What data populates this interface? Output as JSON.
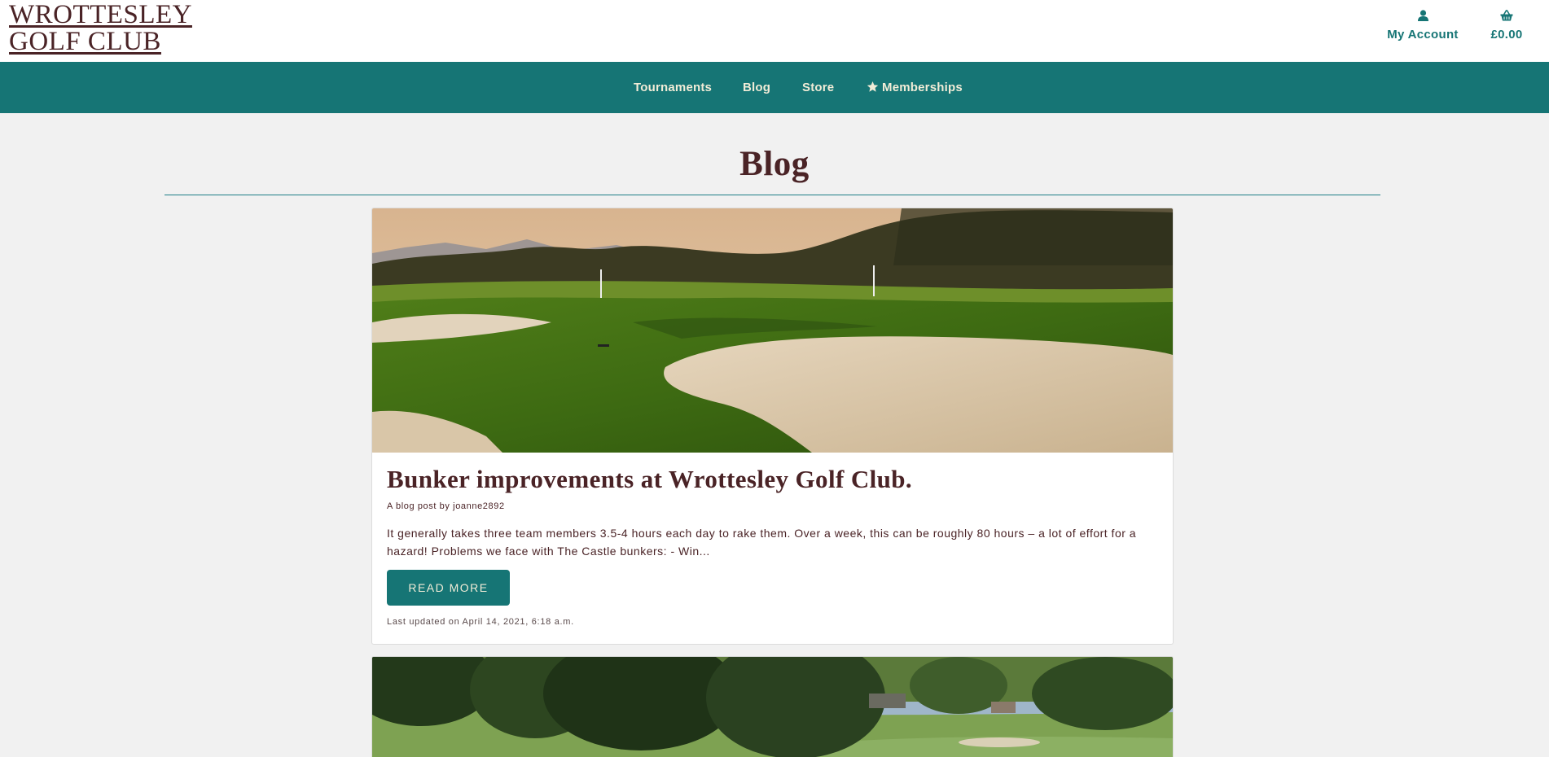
{
  "header": {
    "logo_line1": "WROTTESLEY",
    "logo_line2": "GOLF CLUB",
    "account_label": "My Account",
    "account_icon": "user-icon",
    "bag_total": "£0.00",
    "bag_icon": "basket-icon"
  },
  "nav": {
    "items": [
      {
        "label": "Tournaments"
      },
      {
        "label": "Blog"
      },
      {
        "label": "Store"
      },
      {
        "label": "Memberships",
        "icon": "star-icon"
      }
    ]
  },
  "page": {
    "title": "Blog"
  },
  "posts": [
    {
      "image": "golf-bunker-photo",
      "title": "Bunker improvements at Wrottesley Golf Club.",
      "author": "A blog post by joanne2892",
      "excerpt": "It generally takes three team members 3.5-4 hours each day to rake them. Over a week, this can be roughly 80 hours – a lot of effort for a hazard! Problems we face with The Castle bunkers: - Win...",
      "button_label": "READ MORE",
      "updated": "Last updated on April 14, 2021, 6:18 a.m."
    },
    {
      "image": "golf-course-trees-photo"
    }
  ],
  "colors": {
    "brand_teal": "#167575",
    "brand_maroon": "#4a2326",
    "nav_text": "#f1ecd7",
    "page_bg": "#f1f1f1"
  }
}
